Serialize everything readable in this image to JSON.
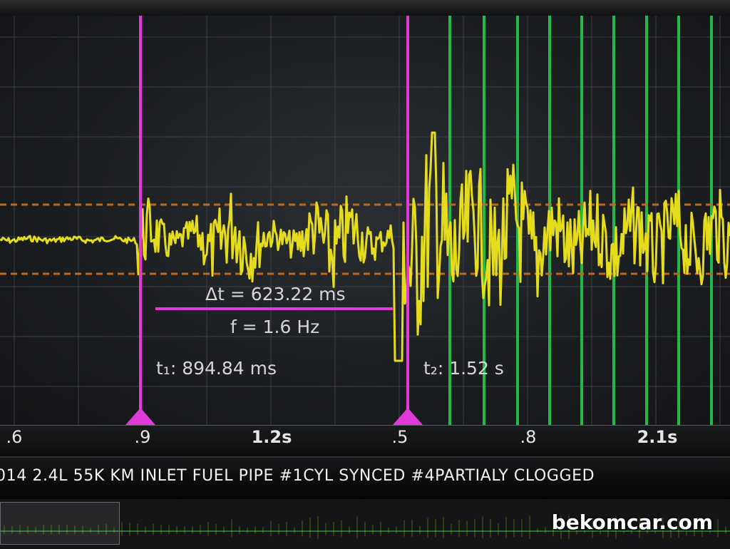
{
  "plot": {
    "colors": {
      "signal": "#e6dc1e",
      "cursor": "#e23ad6",
      "threshold": "#c2661a",
      "marker": "#23b84a",
      "grid": "#3a3f44"
    },
    "cursors": [
      {
        "name": "t1",
        "label": "t₁: 894.84 ms"
      },
      {
        "name": "t2",
        "label": "t₂: 1.52 s"
      }
    ],
    "delta_label": "Δt = 623.22 ms",
    "freq_label": "f = 1.6 Hz"
  },
  "axis": {
    "ticks": [
      ".6",
      ".9",
      "1.2s",
      ".5",
      ".8",
      "2.1s"
    ]
  },
  "caption": "014 2.4L 55K KM INLET FUEL PIPE #1CYL SYNCED #4PARTIALY CLOGGED",
  "watermark": "bekomcar.com"
}
